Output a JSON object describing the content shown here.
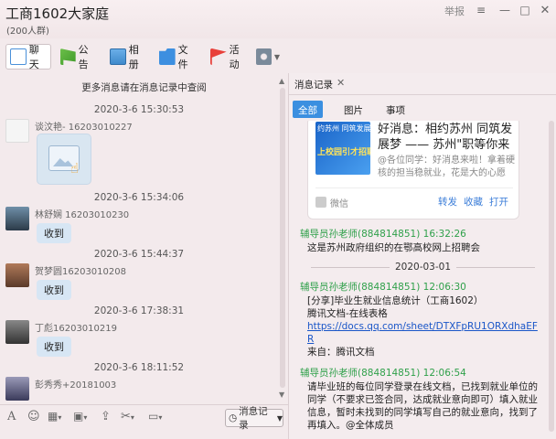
{
  "window": {
    "title": "工商1602大家庭",
    "member_count": "(200人群)",
    "report": "举报"
  },
  "tabs": {
    "chat": "聊天",
    "notice": "公告",
    "album": "相册",
    "files": "文件",
    "activity": "活动"
  },
  "chat": {
    "more_history": "更多消息请在消息记录中查阅",
    "messages": [
      {
        "time": "2020-3-6 15:30:53",
        "sender": "谈汶艳- 16203010227",
        "content": ""
      },
      {
        "time": "2020-3-6 15:34:06",
        "sender": "林舒娴 16203010230",
        "content": "收到"
      },
      {
        "time": "2020-3-6 15:44:37",
        "sender": "贺梦圆16203010208",
        "content": "收到"
      },
      {
        "time": "2020-3-6 17:38:31",
        "sender": "丁彪16203010219",
        "content": "收到"
      },
      {
        "time": "2020-3-6 18:11:52",
        "sender": "彭秀秀+20181003",
        "content": ""
      }
    ],
    "history_button": "消息记录"
  },
  "records": {
    "panel_title": "消息记录",
    "subtabs": {
      "all": "全部",
      "pics": "图片",
      "items": "事项"
    },
    "card": {
      "title": "好消息：相约苏州 同筑发展梦 —— 苏州\"职等你来 · 云\"线上校园引才招聘会...",
      "desc": "@各位同学：好消息来啦！拿着硬核的担当稳就业，花是大的心愿求...",
      "thumb_top": "约苏州 同筑发展",
      "thumb_text": "上校园引才招聘",
      "source": "微信",
      "forward": "转发",
      "favorite": "收藏",
      "open": "打开"
    },
    "msg1": {
      "head": "辅导员孙老师(884814851) 16:32:26",
      "body": "这是苏州政府组织的在鄂高校网上招聘会"
    },
    "date_divider": "2020-03-01",
    "msg2": {
      "head": "辅导员孙老师(884814851) 12:06:30",
      "line1": "[分享]毕业生就业信息统计（工商1602）",
      "line2": "腾讯文档-在线表格",
      "link": "https://docs.qq.com/sheet/DTXFpRU1ORXdhaEFR",
      "line3": "来自：腾讯文档"
    },
    "msg3": {
      "head": "辅导员孙老师(884814851) 12:06:54",
      "body": "请毕业班的每位同学登录在线文档，已找到就业单位的同学（不要求已签合同，达成就业意向即可）填入就业信息，暂时未找到的同学填写自己的就业意向，找到了再填入。@全体成员"
    }
  }
}
